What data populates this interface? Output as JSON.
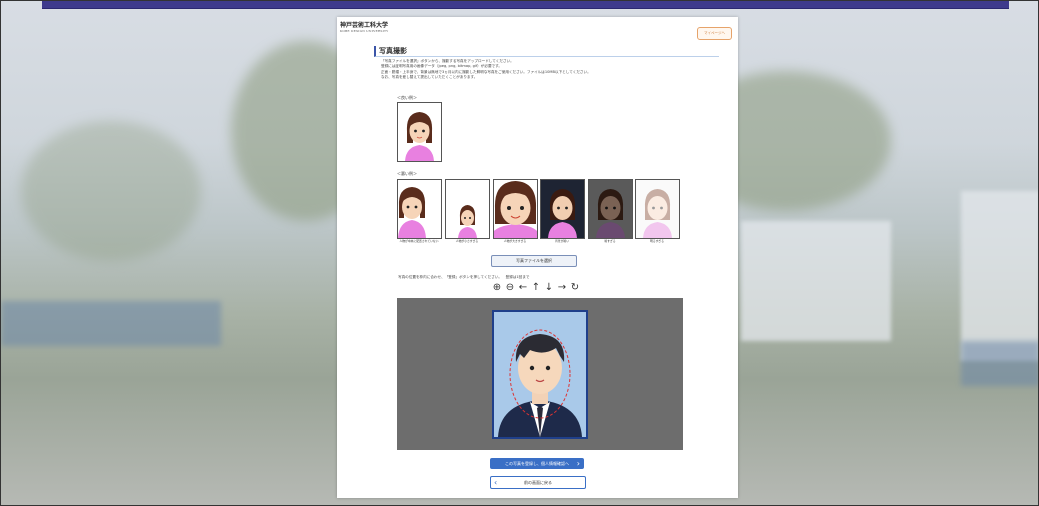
{
  "header": {
    "logo_jp": "神戸芸術工科大学",
    "logo_en": "KOBE DESIGN UNIVERSITY",
    "top_button": "マイページへ"
  },
  "section": {
    "title": "写真撮影",
    "instructions": [
      "「写真ファイルを選択」ボタンから、撮影する写真をアップロードしてください。",
      "登録には証明写真用の画像データ（jpeg, png, bitmap, gif）が必要です。",
      "正面・脱帽・上半身で、背景は無地で3ヵ月以内に撮影した鮮明な写真をご使用ください。ファイルは10MB以下としてください。",
      "なお、写真を差し替えて提出していただくことがあります。"
    ]
  },
  "examples": {
    "good_label": "＜良い例＞",
    "bad_label": "＜悪い例＞",
    "bad_captions": [
      "人物が中央に配置されていない",
      "人物が小さすぎる",
      "人物が大きすぎる",
      "背景が暗い",
      "暗すぎる",
      "明るすぎる"
    ]
  },
  "select_button": "写真ファイルを選択",
  "editor_hint": "写真の位置を枠内に合わせ、「登録」ボタンを押してください。　登録は1回まで",
  "toolbar": {
    "zoom_in": "⊕",
    "zoom_out": "⊖",
    "left": "←",
    "up": "↑",
    "down": "↓",
    "right": "→",
    "rotate": "↻"
  },
  "next_button": "この写真を登録し、個人情報確認へ",
  "back_button": "前の画面に戻る"
}
